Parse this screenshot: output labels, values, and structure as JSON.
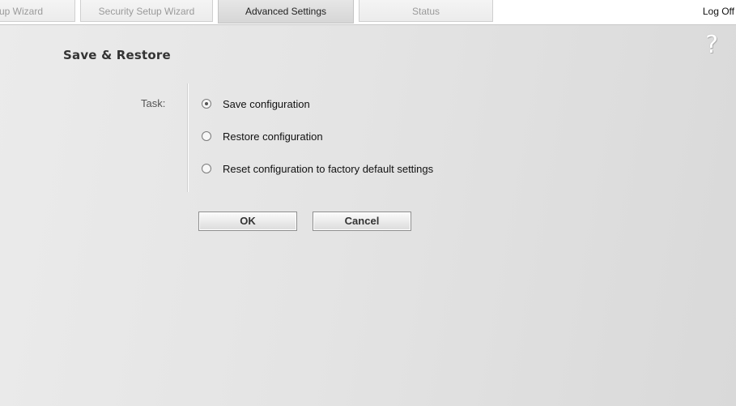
{
  "tabs": [
    {
      "label": "up Wizard",
      "active": false
    },
    {
      "label": "Security Setup Wizard",
      "active": false
    },
    {
      "label": "Advanced Settings",
      "active": true
    },
    {
      "label": "Status",
      "active": false
    }
  ],
  "header": {
    "logoff_label": "Log Off"
  },
  "main": {
    "title": "Save & Restore",
    "help_icon": "?",
    "task_label": "Task:",
    "options": [
      {
        "label": "Save configuration",
        "checked": true
      },
      {
        "label": "Restore configuration",
        "checked": false
      },
      {
        "label": "Reset configuration to factory default settings",
        "checked": false
      }
    ],
    "ok_label": "OK",
    "cancel_label": "Cancel"
  },
  "colors": {
    "panel_background": "#e4e4e4",
    "active_tab": "#d6d6d6",
    "inactive_tab_text": "#9a9a9a"
  }
}
